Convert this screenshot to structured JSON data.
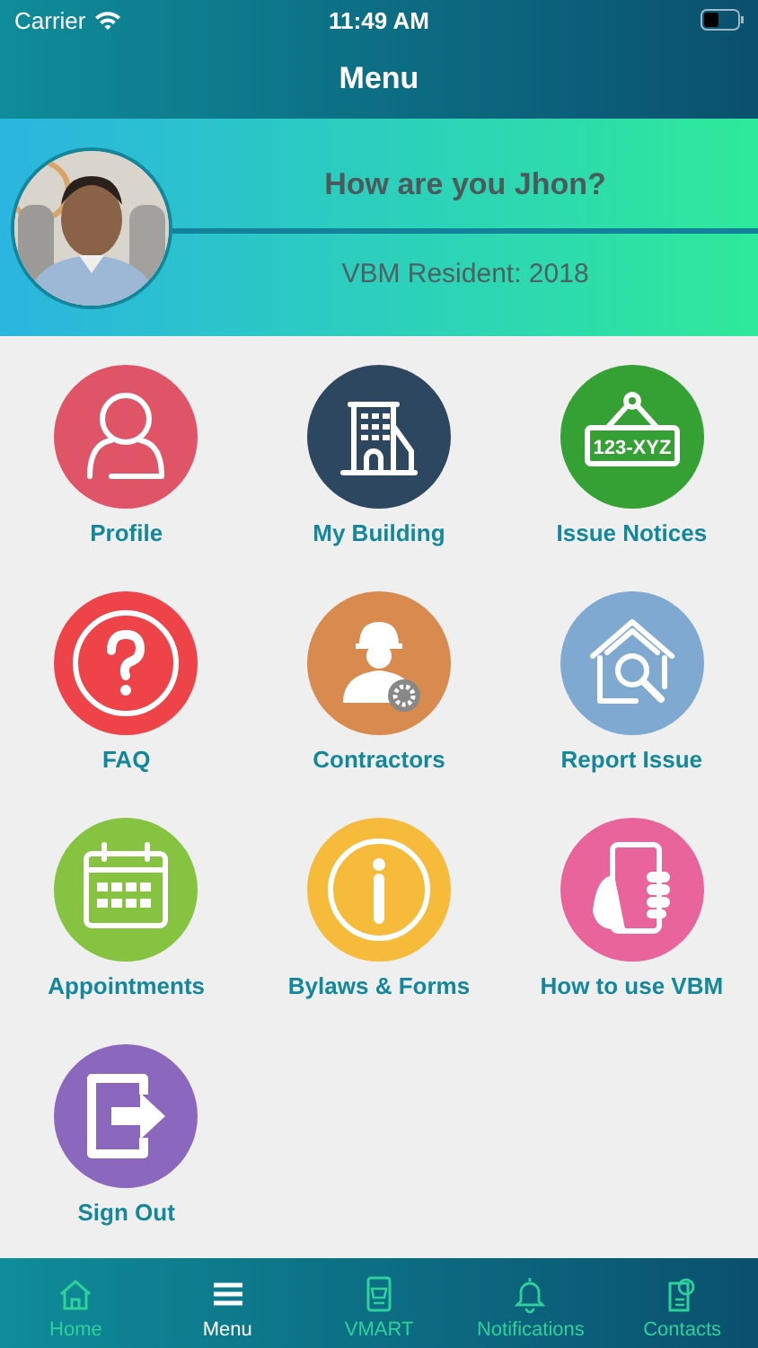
{
  "status_bar": {
    "carrier": "Carrier",
    "time": "11:49 AM"
  },
  "nav": {
    "title": "Menu"
  },
  "header": {
    "greeting": "How are you Jhon?",
    "subtitle": "VBM Resident: 2018"
  },
  "menu_items": [
    {
      "label": "Profile",
      "color": "#e05468"
    },
    {
      "label": "My Building",
      "color": "#2e4760"
    },
    {
      "label": "Issue Notices",
      "color": "#35a033",
      "sign_text": "123-XYZ"
    },
    {
      "label": "FAQ",
      "color": "#ee4349"
    },
    {
      "label": "Contractors",
      "color": "#d98a4e"
    },
    {
      "label": "Report Issue",
      "color": "#7fa9d0"
    },
    {
      "label": "Appointments",
      "color": "#86c340"
    },
    {
      "label": "Bylaws & Forms",
      "color": "#f6bb3b"
    },
    {
      "label": "How to use VBM",
      "color": "#e8649a"
    },
    {
      "label": "Sign Out",
      "color": "#8c67be"
    }
  ],
  "tab_bar": [
    {
      "label": "Home",
      "selected": false
    },
    {
      "label": "Menu",
      "selected": true
    },
    {
      "label": "VMART",
      "selected": false
    },
    {
      "label": "Notifications",
      "selected": false
    },
    {
      "label": "Contacts",
      "selected": false
    }
  ]
}
